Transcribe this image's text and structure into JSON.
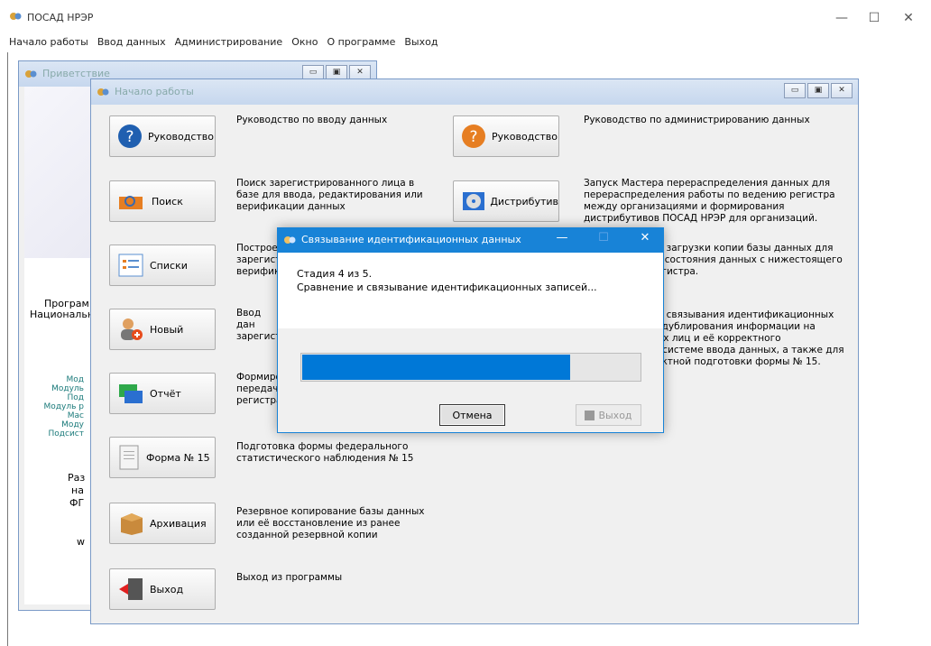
{
  "window": {
    "title": "ПОСАД НРЭР"
  },
  "menu": [
    "Начало работы",
    "Ввод данных",
    "Администрирование",
    "Окно",
    "О программе",
    "Выход"
  ],
  "greeting": {
    "title": "Приветствие",
    "lines": [
      "Програм",
      "Национальн"
    ],
    "small": [
      "Мод",
      "Модуль",
      "Под",
      "Модуль р",
      "Мас",
      "Моду",
      "Подсист"
    ],
    "lower": [
      "Раз",
      "на",
      "ФГ",
      "w"
    ]
  },
  "start": {
    "title": "Начало работы",
    "buttons": [
      {
        "label": "Руководство",
        "desc": "Руководство по вводу данных"
      },
      {
        "label": "Поиск",
        "desc": "Поиск зарегистрированного лица в базе для ввода, редактирования или верификации данных"
      },
      {
        "label": "Списки",
        "desc": "Построен зарегистр верифика"
      },
      {
        "label": "Новый",
        "desc": "Ввод дан зарегистр"
      },
      {
        "label": "Отчёт",
        "desc": "Формиров передачи регистра"
      },
      {
        "label": "Форма № 15",
        "desc": "Подготовка формы федерального статистического наблюдения № 15"
      },
      {
        "label": "Архивация",
        "desc": "Резервное копирование базы данных или её восстановление из ранее созданной резервной копии"
      },
      {
        "label": "Выход",
        "desc": "Выход из программы"
      }
    ],
    "right": [
      {
        "label": "Руководство",
        "desc": "Руководство по администрированию данных"
      },
      {
        "label": "Дистрибутив",
        "desc": "Запуск Мастера перераспределения данных для перераспределения работы по ведению регистра между организациями и формирования дистрибутивов ПОСАД НРЭР для организаций."
      }
    ],
    "right_partial": [
      "ы загрузки копии базы данных для",
      "о состояния данных с нижестоящего",
      "егистра.",
      "ы связывания идентификационных",
      ", дублирования информации на",
      "ых лиц и её корректного",
      "дсистеме ввода данных, а также для",
      "ектной подготовки формы № 15."
    ]
  },
  "dialog": {
    "title": "Связывание идентификационных данных",
    "stage": "Стадия 4 из 5.",
    "message": "Сравнение и связывание идентификационных записей...",
    "progress": 0.79,
    "cancel": "Отмена",
    "exit": "Выход"
  }
}
